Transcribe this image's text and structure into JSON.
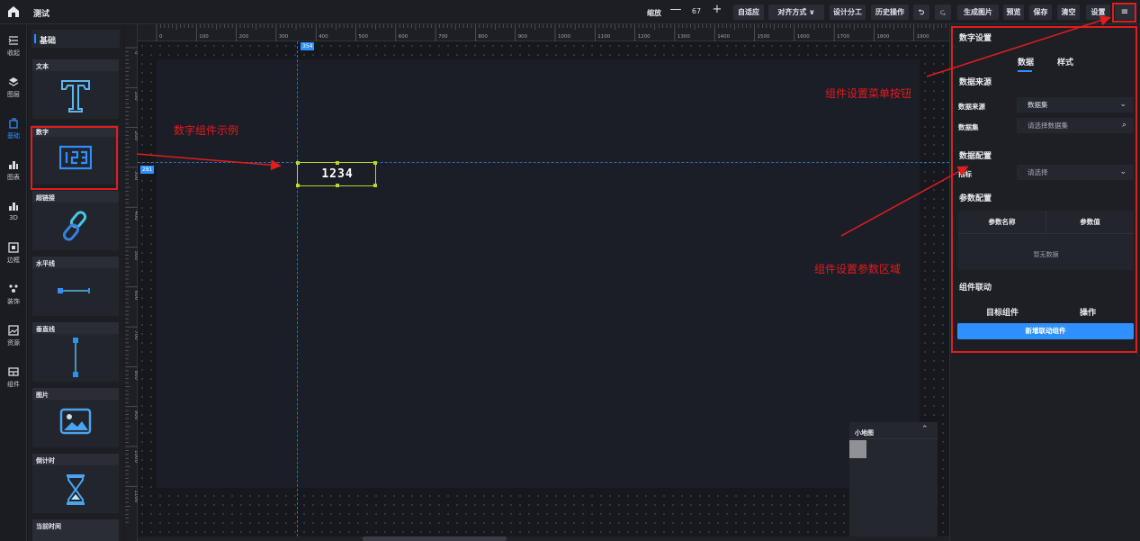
{
  "app": {
    "title": "测试"
  },
  "toolbar": {
    "zoom_label": "缩放",
    "zoom_minus": "—",
    "zoom_value": "67",
    "zoom_plus": "+",
    "buttons": [
      {
        "label": "自适应"
      },
      {
        "label": "对齐方式 ∨"
      },
      {
        "label": "设计分工"
      },
      {
        "label": "历史操作"
      },
      {
        "label": "⮌"
      },
      {
        "label": "⮎"
      },
      {
        "label": "生成图片"
      },
      {
        "label": "预览"
      },
      {
        "label": "保存"
      },
      {
        "label": "清空"
      },
      {
        "label": "设置"
      }
    ],
    "menu_icon": "≡"
  },
  "leftnav": {
    "items": [
      {
        "label": "收起",
        "icon": "collapse-icon"
      },
      {
        "label": "图层",
        "icon": "layers-icon"
      },
      {
        "label": "基础",
        "icon": "basic-icon",
        "active": true
      },
      {
        "label": "图表",
        "icon": "chart-icon"
      },
      {
        "label": "3D",
        "icon": "3d-icon"
      },
      {
        "label": "边框",
        "icon": "border-icon"
      },
      {
        "label": "装饰",
        "icon": "decoration-icon"
      },
      {
        "label": "资源",
        "icon": "resource-icon"
      },
      {
        "label": "组件",
        "icon": "component-icon"
      }
    ]
  },
  "components": {
    "header": "基础",
    "items": [
      {
        "title": "文本",
        "icon": "text-t-icon"
      },
      {
        "title": "数字",
        "icon": "number-123-icon"
      },
      {
        "title": "超链接",
        "icon": "hyperlink-icon"
      },
      {
        "title": "水平线",
        "icon": "horizontal-line-icon"
      },
      {
        "title": "垂直线",
        "icon": "vertical-line-icon"
      },
      {
        "title": "图片",
        "icon": "image-icon"
      },
      {
        "title": "倒计时",
        "icon": "hourglass-icon"
      },
      {
        "title": "当前时间",
        "icon": "clock-icon"
      }
    ]
  },
  "ruler": {
    "h_labels": [
      "0",
      "100",
      "200",
      "300",
      "400",
      "500",
      "600",
      "700",
      "800",
      "900",
      "1000",
      "1100",
      "1200",
      "1300",
      "1400",
      "1500",
      "1600",
      "1700",
      "1800",
      "1900"
    ],
    "v_labels": [
      "0",
      "100",
      "200",
      "300",
      "400",
      "500",
      "600",
      "700",
      "800",
      "900",
      "1000",
      "1100"
    ],
    "guide_x": "354",
    "guide_y": "281"
  },
  "canvas": {
    "number_widget_value": "1234"
  },
  "minimap": {
    "title": "小地图",
    "toggle": "⌃"
  },
  "settings": {
    "title": "数字设置",
    "tabs": [
      "数据",
      "样式"
    ],
    "sections": {
      "source": "数据来源",
      "data_config": "数据配置",
      "params": "参数配置",
      "linkage": "组件联动"
    },
    "source_label": "数据来源",
    "source_value": "数据集",
    "dataset_label": "数据集",
    "dataset_placeholder": "请选择数据集",
    "metric_label": "指标",
    "metric_placeholder": "请选择",
    "param_name_header": "参数名称",
    "param_value_header": "参数值",
    "param_empty": "暂无数据",
    "target_component": "目标组件",
    "operation": "操作",
    "add_link_button": "新增联动组件"
  },
  "annotations": {
    "number_example": "数字组件示例",
    "menu_button": "组件设置菜单按钮",
    "param_area": "组件设置参数区域"
  },
  "colors": {
    "accent": "#2f8fff",
    "annotation": "#e11d1d",
    "selection": "#b8d72a"
  }
}
